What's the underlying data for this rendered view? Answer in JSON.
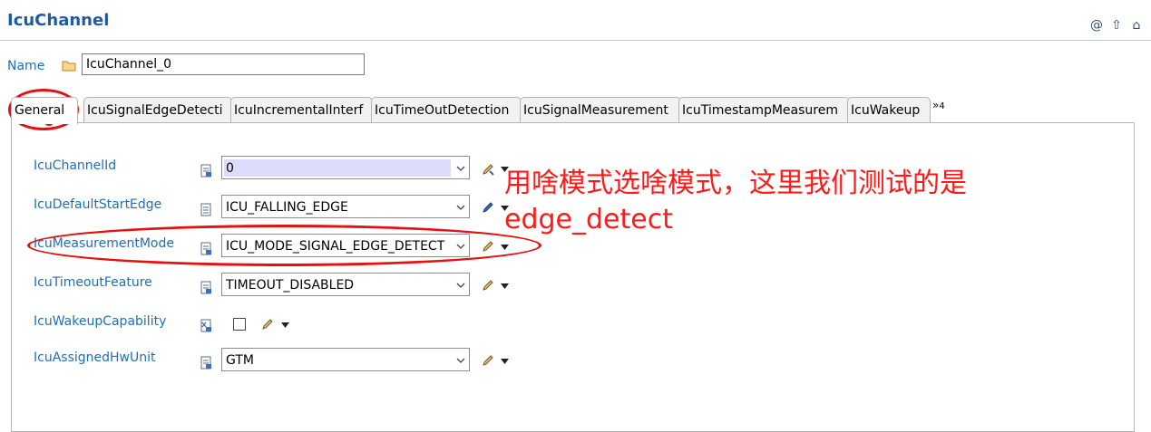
{
  "header": {
    "title": "IcuChannel",
    "icons": [
      "at-icon",
      "up-arrow-icon",
      "home-icon"
    ]
  },
  "name_field": {
    "label": "Name",
    "value": "IcuChannel_0"
  },
  "tabs": [
    {
      "label": "General",
      "active": true
    },
    {
      "label": "IcuSignalEdgeDetecti"
    },
    {
      "label": "IcuIncrementalInterf"
    },
    {
      "label": "IcuTimeOutDetection"
    },
    {
      "label": "IcuSignalMeasurement"
    },
    {
      "label": "IcuTimestampMeasurem"
    },
    {
      "label": "IcuWakeup"
    }
  ],
  "tabs_overflow": {
    "chevron": "»",
    "count": "4"
  },
  "rows": [
    {
      "label": "IcuChannelId",
      "value": "0",
      "type": "select"
    },
    {
      "label": "IcuDefaultStartEdge",
      "value": "ICU_FALLING_EDGE",
      "type": "select"
    },
    {
      "label": "IcuMeasurementMode",
      "value": "ICU_MODE_SIGNAL_EDGE_DETECT",
      "type": "select"
    },
    {
      "label": "IcuTimeoutFeature",
      "value": "TIMEOUT_DISABLED",
      "type": "select"
    },
    {
      "label": "IcuWakeupCapability",
      "value": "",
      "type": "checkbox"
    },
    {
      "label": "IcuAssignedHwUnit",
      "value": "GTM",
      "type": "select"
    }
  ],
  "annotation": {
    "line1": "用啥模式选啥模式，这里我们测试的是",
    "line2": "edge_detect",
    "color": "#ff1a1a"
  },
  "colors": {
    "accent": "#1f6fb5",
    "title": "#1f5aa6",
    "highlight": "#dcdcfa",
    "annotation": "#e51010"
  }
}
